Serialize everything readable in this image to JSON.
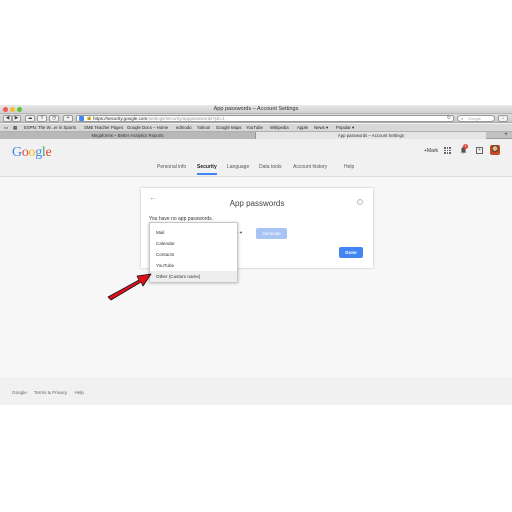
{
  "window": {
    "title": "App passwords – Account Settings"
  },
  "toolbar": {
    "url_host": "https://security.google.com",
    "url_path": "/settings/security/apppasswords?pli=1",
    "search_placeholder": "Google"
  },
  "bookmarks": [
    "ESPN: The W...er in Sports",
    "SME Teacher Pages",
    "Google Docs – Home",
    "edmodo",
    "Yahoo!",
    "Google Maps",
    "YouTube",
    "Wikipedia",
    "Apple",
    "News ▾",
    "Popular ▾"
  ],
  "tabs": [
    {
      "label": "Megaforms – Better Analytics Reports"
    },
    {
      "label": "App passwords – Account Settings"
    }
  ],
  "header": {
    "logo_letters": [
      "G",
      "o",
      "o",
      "g",
      "l",
      "e"
    ],
    "plus_name": "+Mark",
    "notification_count": "1"
  },
  "nav": [
    "Personal info",
    "Security",
    "Language",
    "Data tools",
    "Account history",
    "Help"
  ],
  "card": {
    "title": "App passwords",
    "message": "You have no app passwords.",
    "device_fragment": "e ▾",
    "generate_label": "Generate",
    "done_label": "Done"
  },
  "dropdown": {
    "items": [
      "Mail",
      "Calendar",
      "Contacts",
      "YouTube",
      "Other (Custom name)"
    ],
    "highlighted_index": 4
  },
  "footer": [
    "Google",
    "Terms & Privacy",
    "Help"
  ],
  "colors": {
    "accent": "#4285f4",
    "annotation_arrow": "#e0101a"
  }
}
